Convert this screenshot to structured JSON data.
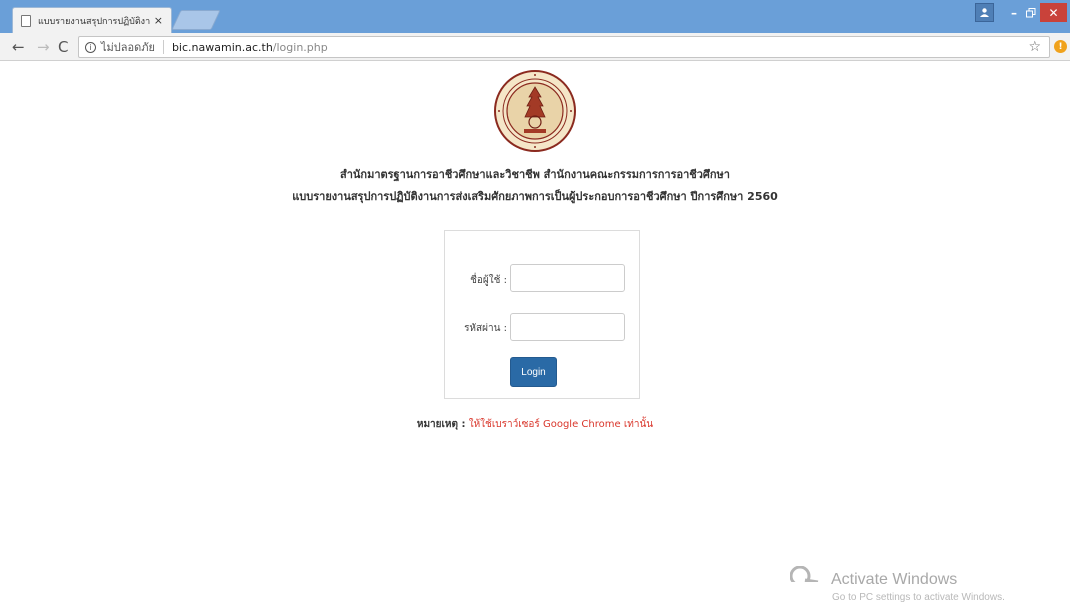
{
  "browser": {
    "tab_title": "แบบรายงานสรุปการปฏิบัติงา",
    "tab_close": "×",
    "secure_label": "ไม่ปลอดภัย",
    "url_host": "bic.nawamin.ac.th",
    "url_path": "/login.php",
    "bookmark_icon": "star-icon",
    "extension_badge": "!"
  },
  "page": {
    "heading_line1": "สำนักมาตรฐานการอาชีวศึกษาและวิชาชีพ สำนักงานคณะกรรมการการอาชีวศึกษา",
    "heading_line2": "แบบรายงานสรุปการปฏิบัติงานการส่งเสริมศักยภาพการเป็นผู้ประกอบการอาชีวศึกษา ปีการศึกษา 2560",
    "login": {
      "username_label": "ชื่อผู้ใช้ :",
      "username_value": "",
      "password_label": "รหัสผ่าน :",
      "password_value": "",
      "button_label": "Login"
    },
    "note_label": "หมายเหตุ :",
    "note_text": "ให้ใช้เบราว์เซอร์ Google Chrome เท่านั้น"
  },
  "watermark": {
    "title": "Activate Windows",
    "subtitle": "Go to PC settings to activate Windows."
  },
  "colors": {
    "titlebar": "#6a9fd8",
    "login_button": "#2a6aa6",
    "note_text": "#d9352a",
    "seal": "#8b2a1f"
  }
}
